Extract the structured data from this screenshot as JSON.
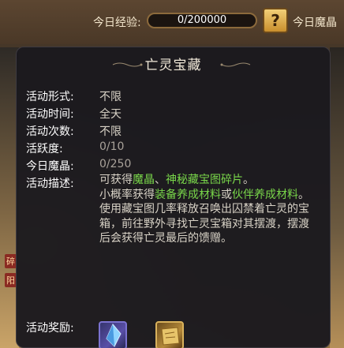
{
  "topbar": {
    "exp_label": "今日经验:",
    "exp_value": "0/200000",
    "exp_progress": 0,
    "help_label": "?",
    "magic_label": "今日魔晶"
  },
  "background": {
    "tag_1": "碎",
    "tag_2": "阳"
  },
  "panel": {
    "title": "亡灵宝藏",
    "rows": [
      {
        "label": "活动形式:",
        "value": "不限"
      },
      {
        "label": "活动时间:",
        "value": "全天"
      },
      {
        "label": "活动次数:",
        "value": "不限"
      },
      {
        "label": "活跃度:",
        "value": "0/10"
      },
      {
        "label": "今日魔晶:",
        "value": "0/250"
      }
    ],
    "desc_label": "活动描述:",
    "desc": {
      "p1_a": "可获得",
      "p1_b": "魔晶",
      "p1_c": "、",
      "p1_d": "神秘藏宝图碎片",
      "p1_e": "。",
      "p2_a": "小概率获得",
      "p2_b": "装备养成材料",
      "p2_c": "或",
      "p2_d": "伙伴养成材料",
      "p2_e": "。",
      "p3": "使用藏宝图几率释放召唤出囚禁着亡灵的宝箱，前往野外寻找亡灵宝箱对其摆渡，摆渡后会获得亡灵最后的馈赠。"
    },
    "reward_label": "活动奖励:",
    "rewards": [
      {
        "icon": "blue-crystal-icon"
      },
      {
        "icon": "gold-treasure-map-icon"
      }
    ]
  },
  "colors": {
    "highlight_green": "#79d64a",
    "panel_bg": "#1a191e",
    "label_white": "#ffffff",
    "value_grey": "#d8d2c6"
  }
}
